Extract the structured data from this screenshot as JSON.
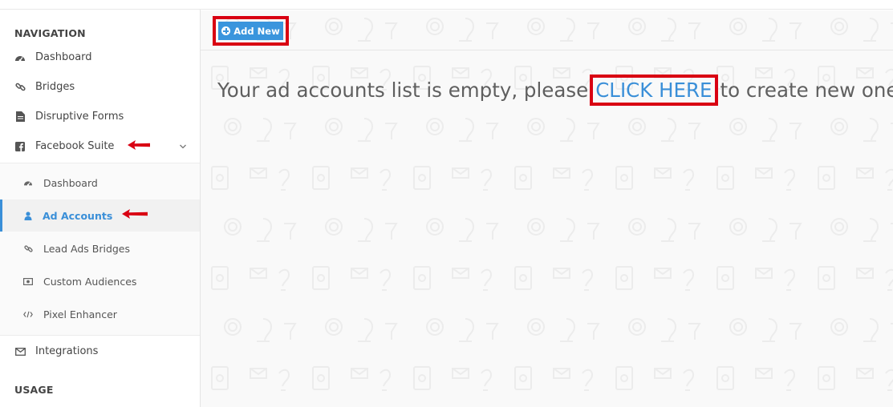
{
  "sidebar": {
    "section_navigation": "NAVIGATION",
    "section_usage": "USAGE",
    "items": [
      {
        "label": "Dashboard",
        "icon": "dashboard-icon"
      },
      {
        "label": "Bridges",
        "icon": "link-icon"
      },
      {
        "label": "Disruptive Forms",
        "icon": "file-icon"
      },
      {
        "label": "Facebook Suite",
        "icon": "facebook-icon"
      },
      {
        "label": "Integrations",
        "icon": "envelope-icon"
      }
    ],
    "submenu": [
      {
        "label": "Dashboard",
        "icon": "dashboard-icon"
      },
      {
        "label": "Ad Accounts",
        "icon": "user-icon",
        "active": true
      },
      {
        "label": "Lead Ads Bridges",
        "icon": "link-icon"
      },
      {
        "label": "Custom Audiences",
        "icon": "money-icon"
      },
      {
        "label": "Pixel Enhancer",
        "icon": "code-icon"
      }
    ]
  },
  "toolbar": {
    "add_new_label": "Add New"
  },
  "main": {
    "empty_prefix": "Your ad accounts list is empty, please",
    "link_text": "CLICK HERE",
    "empty_suffix": "to create new one."
  },
  "colors": {
    "accent": "#3a8fd8",
    "button": "#3a95dd",
    "highlight": "#d90012"
  }
}
